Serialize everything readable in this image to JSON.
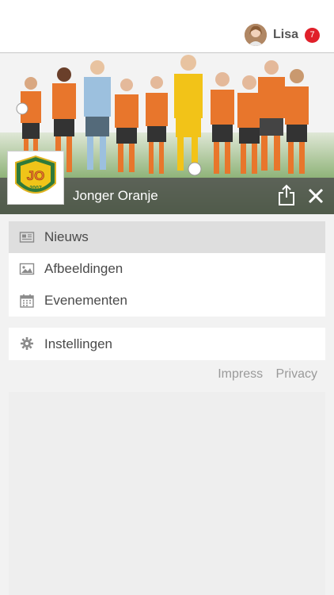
{
  "user": {
    "name": "Lisa",
    "notification_count": "7"
  },
  "team": {
    "name": "Jonger Oranje",
    "logo_text": "JO",
    "logo_year": "2007"
  },
  "menu": {
    "primary": [
      {
        "label": "Nieuws",
        "icon": "newspaper-icon",
        "active": true
      },
      {
        "label": "Afbeeldingen",
        "icon": "image-icon",
        "active": false
      },
      {
        "label": "Evenementen",
        "icon": "calendar-icon",
        "active": false
      }
    ],
    "secondary": [
      {
        "label": "Instellingen",
        "icon": "gear-icon",
        "active": false
      }
    ]
  },
  "footer": {
    "impress": "Impress",
    "privacy": "Privacy"
  },
  "colors": {
    "accent": "#e0202a",
    "team_orange": "#e8762c",
    "bar": "#505050"
  }
}
